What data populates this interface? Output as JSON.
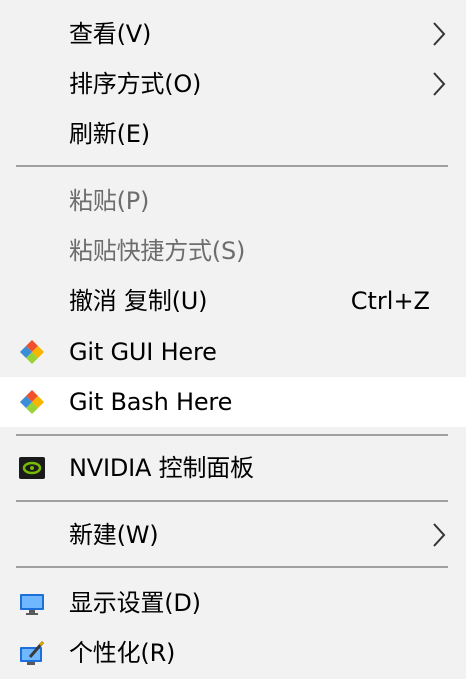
{
  "context_menu": {
    "items": [
      {
        "label": "查看(V)",
        "has_submenu": true
      },
      {
        "label": "排序方式(O)",
        "has_submenu": true
      },
      {
        "label": "刷新(E)"
      },
      {
        "label": "粘贴(P)",
        "disabled": true
      },
      {
        "label": "粘贴快捷方式(S)",
        "disabled": true
      },
      {
        "label": "撤消 复制(U)",
        "shortcut": "Ctrl+Z"
      },
      {
        "label": "Git GUI Here",
        "icon": "git-icon"
      },
      {
        "label": "Git Bash Here",
        "icon": "git-icon",
        "highlighted": true
      },
      {
        "label": "NVIDIA 控制面板",
        "icon": "nvidia-icon"
      },
      {
        "label": "新建(W)",
        "has_submenu": true
      },
      {
        "label": "显示设置(D)",
        "icon": "display-settings-icon"
      },
      {
        "label": "个性化(R)",
        "icon": "personalize-icon"
      }
    ]
  },
  "colors": {
    "menu_background": "#f2f2f2",
    "highlight_background": "#ffffff",
    "disabled_text": "#6d6d6d",
    "separator": "#a0a0a0",
    "nvidia_green": "#76b900"
  }
}
